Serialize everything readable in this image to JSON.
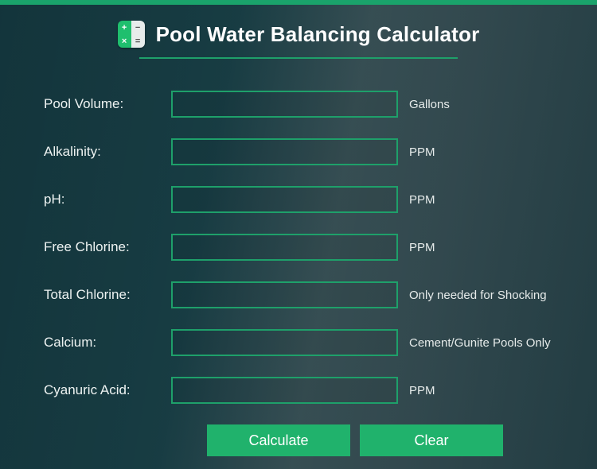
{
  "header": {
    "title": "Pool Water Balancing Calculator"
  },
  "fields": {
    "pool_volume": {
      "label": "Pool Volume:",
      "value": "",
      "unit": "Gallons"
    },
    "alkalinity": {
      "label": "Alkalinity:",
      "value": "",
      "unit": "PPM"
    },
    "ph": {
      "label": "pH:",
      "value": "",
      "unit": "PPM"
    },
    "free_chlorine": {
      "label": "Free Chlorine:",
      "value": "",
      "unit": "PPM"
    },
    "total_chlorine": {
      "label": "Total Chlorine:",
      "value": "",
      "unit": "Only needed for Shocking"
    },
    "calcium": {
      "label": "Calcium:",
      "value": "",
      "unit": "Cement/Gunite Pools Only"
    },
    "cyanuric_acid": {
      "label": "Cyanuric Acid:",
      "value": "",
      "unit": "PPM"
    }
  },
  "buttons": {
    "calculate": "Calculate",
    "clear": "Clear"
  },
  "colors": {
    "accent": "#1ea06a",
    "button": "#20b26c"
  }
}
